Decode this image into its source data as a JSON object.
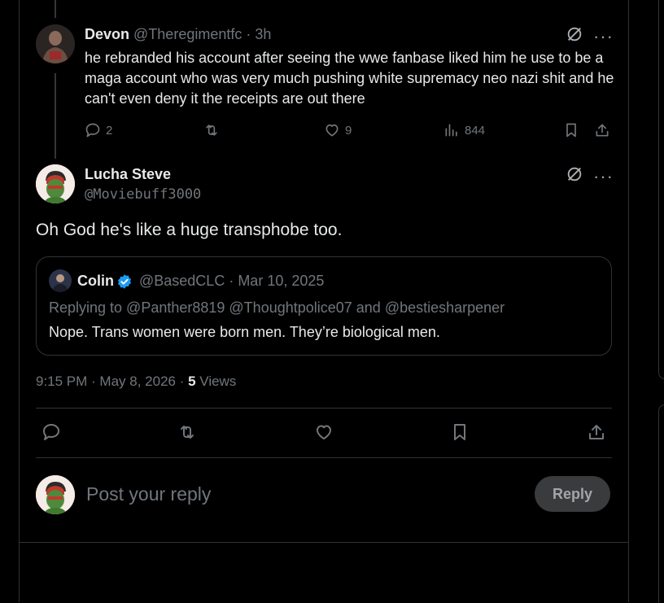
{
  "parent_tweet": {
    "author_name": "Devon",
    "handle_time": "@Theregimentfc · 3h",
    "text": "he rebranded his account after seeing the wwe fanbase liked him he use to be a maga account who was very much pushing white supremacy neo nazi shit and he can't even deny it the receipts are out there",
    "replies": "2",
    "likes": "9",
    "views": "844"
  },
  "main_tweet": {
    "author_name": "Lucha Steve",
    "handle": "@Moviebuff3000",
    "text": "Oh God he's like a huge transphobe too.",
    "timestamp": "9:15 PM · May 8, 2026 · ",
    "view_count": "5",
    "view_label": " Views"
  },
  "quoted_tweet": {
    "author_name": "Colin",
    "handle_date": "@BasedCLC · Mar 10, 2025",
    "replying_to": "Replying to @Panther8819 @Thoughtpolice07 and @bestiesharpener",
    "text": "Nope. Trans women were born men. They’re biological men."
  },
  "composer": {
    "placeholder": "Post your reply",
    "reply_label": "Reply"
  },
  "colors": {
    "background": "#000000",
    "border": "#2f3336",
    "muted_text": "#71767b",
    "verified": "#1d9bf0"
  }
}
